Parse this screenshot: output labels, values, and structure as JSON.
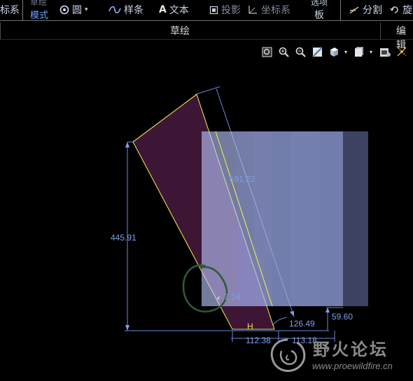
{
  "ribbon": {
    "left_cut": "标系",
    "mode_label": "模式",
    "mode_top_cut": "草绘",
    "circle": "圆",
    "spline": "样条",
    "text": "文本",
    "project": "投影",
    "coordsys": "坐标系",
    "palette_top": "选项",
    "palette_bottom": "板",
    "divide": "分割",
    "rotate_cut": "旋"
  },
  "groups": {
    "sketch": "草绘",
    "edit_cut": "编辑"
  },
  "view_toolbar": [
    {
      "icon": "zoom-fit-icon"
    },
    {
      "icon": "zoom-in-icon"
    },
    {
      "icon": "zoom-out-icon"
    },
    {
      "icon": "repaint-icon"
    },
    {
      "icon": "saved-views-icon"
    },
    {
      "icon": "display-style-icon"
    },
    {
      "icon": "sketch-settings-icon"
    },
    {
      "icon": "sketch-display-icon"
    }
  ],
  "dimensions": {
    "height": "445.91",
    "slant": "591.22",
    "bottom_left": "112.38",
    "bottom_right": "113.18",
    "angle_right": "126.49",
    "small": "59.60",
    "circled": "7.24",
    "constraint_h": "H"
  },
  "colors": {
    "background": "#000000",
    "sketch_fill": "#3d1535",
    "sketch_edge": "#e8e04a",
    "dimension": "#7f9fe6",
    "overlay": "#b9c6ff",
    "circle_mark": "#2f5a33"
  },
  "watermark": {
    "name": "野火论坛",
    "url": "www.proewildfire.cn"
  }
}
